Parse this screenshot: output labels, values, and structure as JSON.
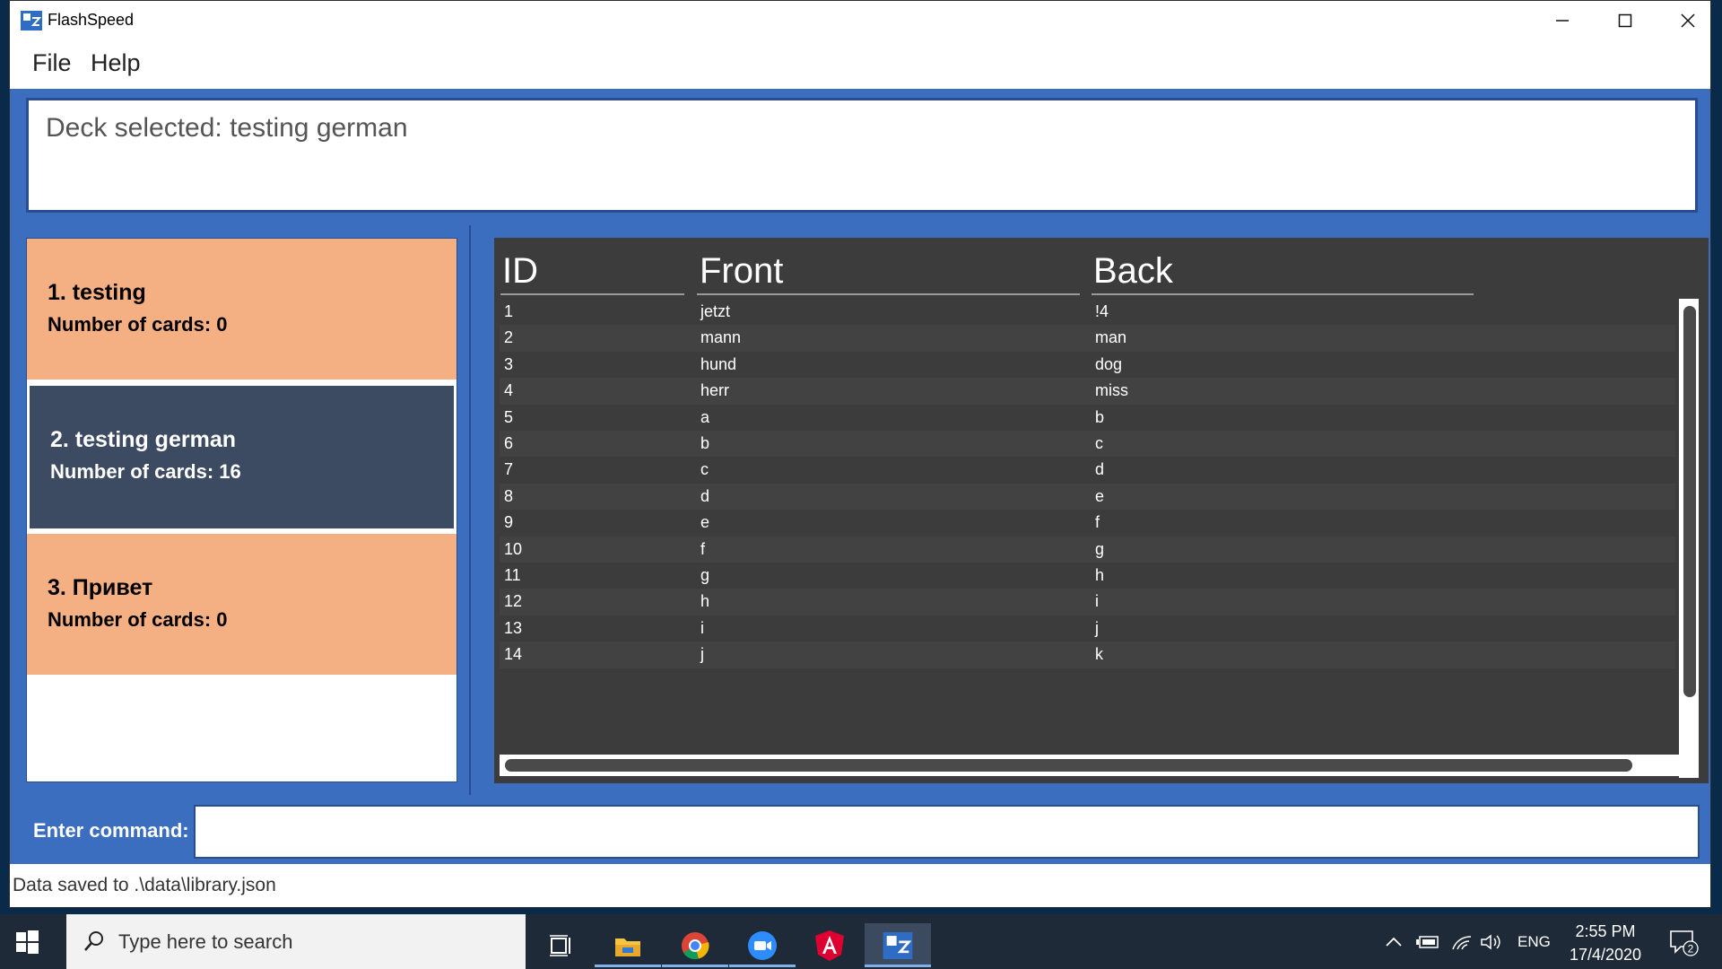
{
  "window": {
    "title": "FlashSpeed"
  },
  "menu": [
    "File",
    "Help"
  ],
  "result": {
    "text": "Deck selected: testing german"
  },
  "decks": [
    {
      "title": "1.  testing",
      "count": "Number of cards: 0",
      "state": "normal"
    },
    {
      "title": "2.  testing german",
      "count": "Number of cards: 16",
      "state": "selected"
    },
    {
      "title": "3.  Привет",
      "count": "Number of cards: 0",
      "state": "normal"
    }
  ],
  "table": {
    "columns": [
      "ID",
      "Front",
      "Back"
    ],
    "rows": [
      [
        "1",
        "jetzt",
        "!4"
      ],
      [
        "2",
        "mann",
        "man"
      ],
      [
        "3",
        "hund",
        "dog"
      ],
      [
        "4",
        "herr",
        "miss"
      ],
      [
        "5",
        "a",
        "b"
      ],
      [
        "6",
        "b",
        "c"
      ],
      [
        "7",
        "c",
        "d"
      ],
      [
        "8",
        "d",
        "e"
      ],
      [
        "9",
        "e",
        "f"
      ],
      [
        "10",
        "f",
        "g"
      ],
      [
        "11",
        "g",
        "h"
      ],
      [
        "12",
        "h",
        "i"
      ],
      [
        "13",
        "i",
        "j"
      ],
      [
        "14",
        "j",
        "k"
      ]
    ]
  },
  "command": {
    "label": "Enter command:",
    "value": ""
  },
  "status": {
    "text": "Data saved to .\\data\\library.json"
  },
  "taskbar": {
    "search_placeholder": "Type here to search",
    "language": "ENG",
    "time": "2:55 PM",
    "date": "17/4/2020",
    "notifications": "2"
  },
  "colors": {
    "accent": "#3c6ec0",
    "deck_orange": "#f4af82",
    "deck_selected": "#3c4a62",
    "table_bg": "#3c3c3c"
  }
}
